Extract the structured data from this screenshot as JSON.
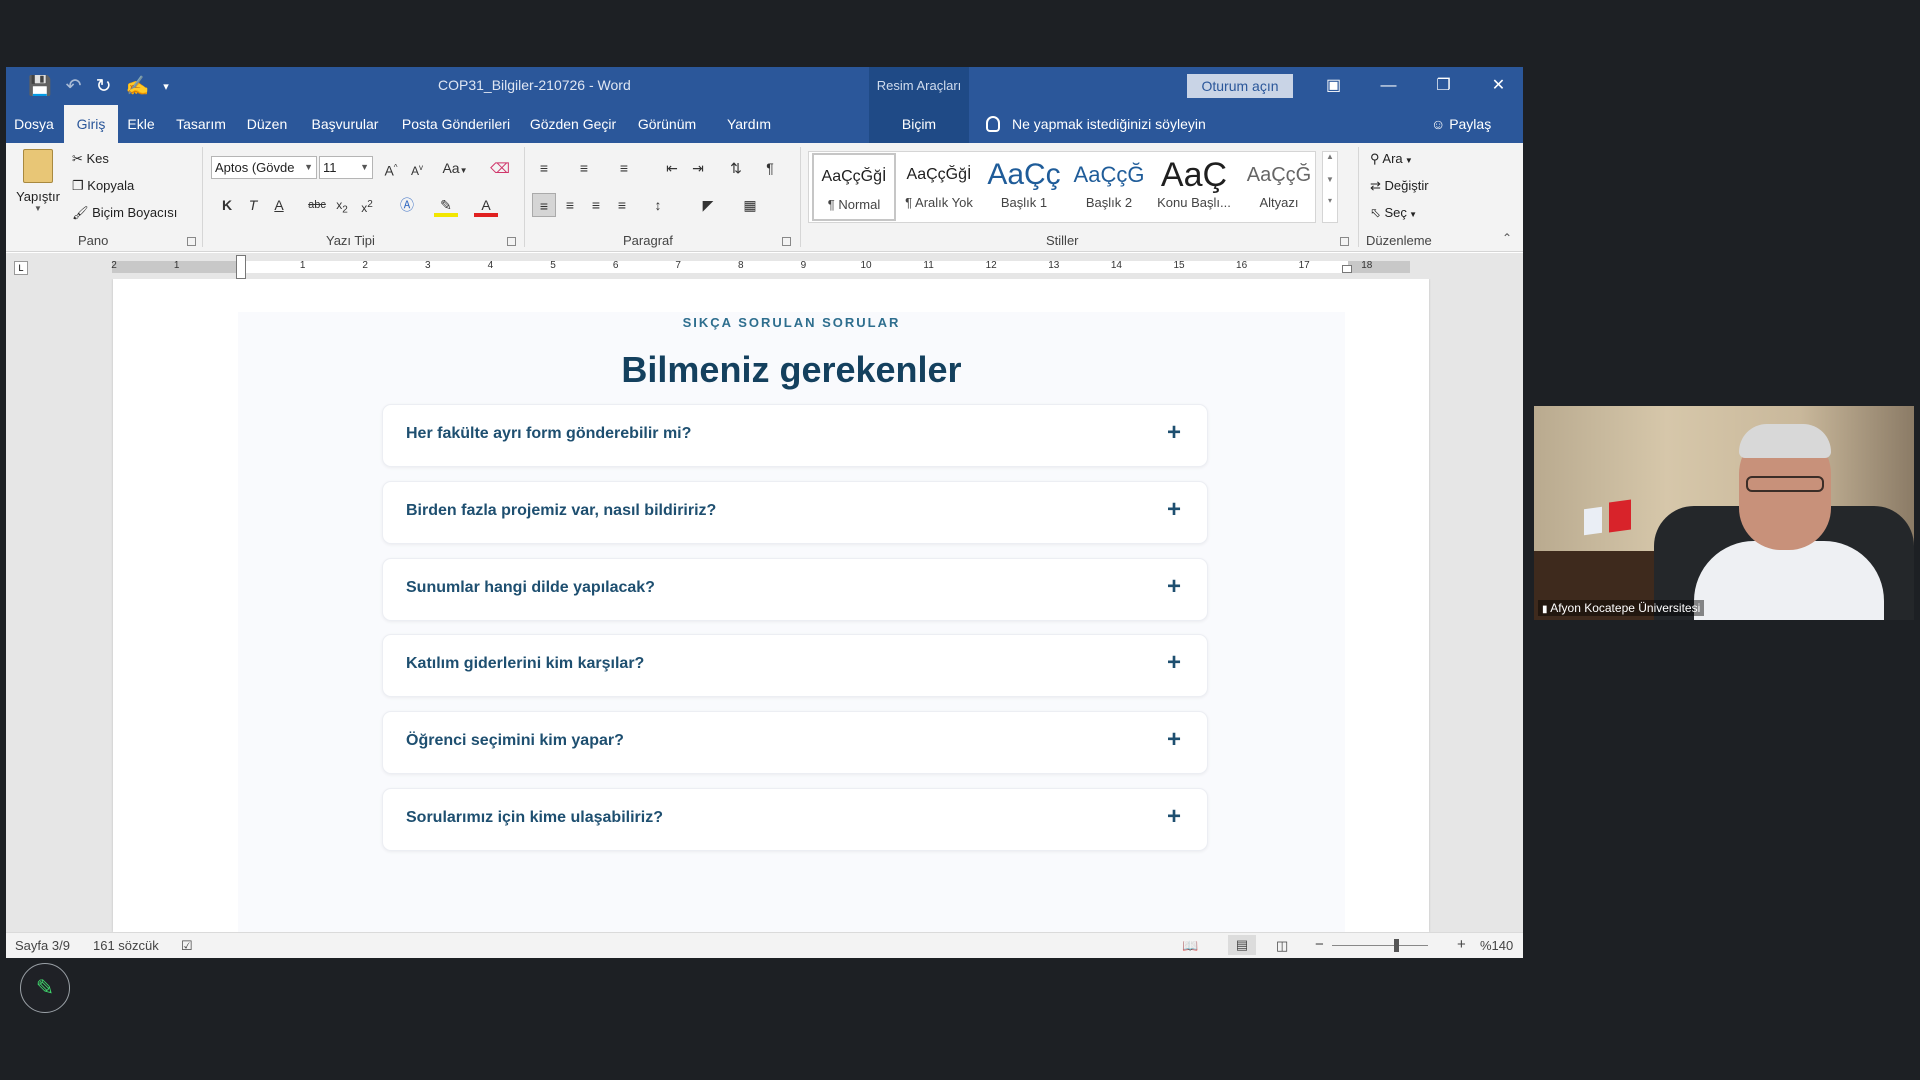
{
  "window": {
    "doc_title": "COP31_Bilgiler-210726  -  Word",
    "context_title": "Resim Araçları",
    "signin_label": "Oturum açın"
  },
  "tabs": [
    {
      "label": "Dosya"
    },
    {
      "label": "Giriş"
    },
    {
      "label": "Ekle"
    },
    {
      "label": "Tasarım"
    },
    {
      "label": "Düzen"
    },
    {
      "label": "Başvurular"
    },
    {
      "label": "Posta Gönderileri"
    },
    {
      "label": "Gözden Geçir"
    },
    {
      "label": "Görünüm"
    },
    {
      "label": "Yardım"
    },
    {
      "label": "Biçim"
    }
  ],
  "tell_me": "Ne yapmak istediğinizi söyleyin",
  "share_label": "Paylaş",
  "ribbon": {
    "clipboard": {
      "paste": "Yapıştır",
      "cut": "Kes",
      "copy": "Kopyala",
      "format_painter": "Biçim Boyacısı",
      "group": "Pano"
    },
    "font": {
      "name": "Aptos (Gövde",
      "size": "11",
      "group": "Yazı Tipi",
      "change_case": "Aa",
      "bold": "K",
      "italic": "T",
      "underline": "A",
      "strike": "abc",
      "font_color": "A"
    },
    "paragraph": {
      "group": "Paragraf"
    },
    "styles": {
      "group": "Stiller",
      "items": [
        {
          "preview": "AaÇçĞğİ",
          "name": "¶ Normal"
        },
        {
          "preview": "AaÇçĞğİ",
          "name": "¶ Aralık Yok"
        },
        {
          "preview": "AaÇç",
          "name": "Başlık 1"
        },
        {
          "preview": "AaÇçĞ",
          "name": "Başlık 2"
        },
        {
          "preview": "AaÇ",
          "name": "Konu Başlı..."
        },
        {
          "preview": "AaÇçĞ",
          "name": "Altyazı"
        }
      ]
    },
    "editing": {
      "group": "Düzenleme",
      "find": "Ara",
      "replace": "Değiştir",
      "select": "Seç"
    }
  },
  "ruler": {
    "labels": [
      "2",
      "1",
      "1",
      "2",
      "3",
      "4",
      "5",
      "6",
      "7",
      "8",
      "9",
      "10",
      "11",
      "12",
      "13",
      "14",
      "15",
      "16",
      "17",
      "18"
    ]
  },
  "faq": {
    "kicker": "SIKÇA SORULAN SORULAR",
    "title": "Bilmeniz gerekenler",
    "questions": [
      "Her fakülte ayrı form gönderebilir mi?",
      "Birden fazla projemiz var, nasıl bildiririz?",
      "Sunumlar hangi dilde yapılacak?",
      "Katılım giderlerini kim karşılar?",
      "Öğrenci seçimini kim yapar?",
      "Sorularımız için kime ulaşabiliriz?"
    ],
    "expand_symbol": "+"
  },
  "status": {
    "page": "Sayfa 3/9",
    "words": "161 sözcük",
    "zoom": "%140",
    "zoom_level_percent": 140
  },
  "webcam": {
    "participant": "Afyon Kocatepe Üniversitesi"
  },
  "colors": {
    "word_blue": "#2b579a",
    "faq_title": "#14405e",
    "faq_text": "#1e4f70"
  }
}
